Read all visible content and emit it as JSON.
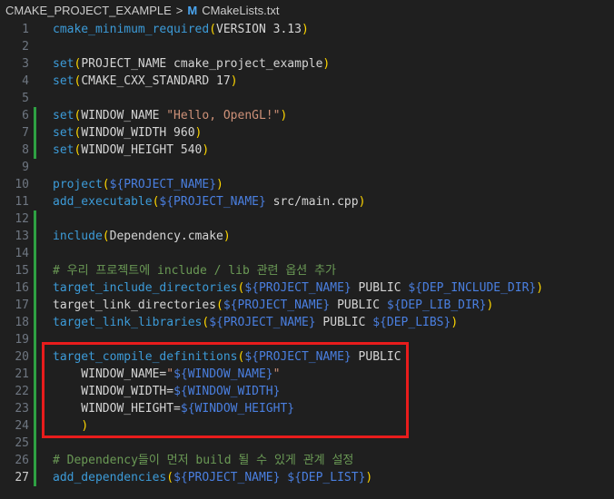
{
  "breadcrumb": {
    "folder": "CMAKE_PROJECT_EXAMPLE",
    "separator": ">",
    "file_icon": "M",
    "file": "CMakeLists.txt"
  },
  "editor": {
    "active_line": 27,
    "lines": [
      {
        "n": 1,
        "tokens": [
          [
            "fn",
            "cmake_minimum_required"
          ],
          [
            "pn",
            "("
          ],
          [
            "id",
            "VERSION 3.13"
          ],
          [
            "pn",
            ")"
          ]
        ]
      },
      {
        "n": 2,
        "tokens": []
      },
      {
        "n": 3,
        "tokens": [
          [
            "fn",
            "set"
          ],
          [
            "pn",
            "("
          ],
          [
            "id",
            "PROJECT_NAME cmake_project_example"
          ],
          [
            "pn",
            ")"
          ]
        ]
      },
      {
        "n": 4,
        "tokens": [
          [
            "fn",
            "set"
          ],
          [
            "pn",
            "("
          ],
          [
            "id",
            "CMAKE_CXX_STANDARD 17"
          ],
          [
            "pn",
            ")"
          ]
        ]
      },
      {
        "n": 5,
        "tokens": []
      },
      {
        "n": 6,
        "tokens": [
          [
            "fn",
            "set"
          ],
          [
            "pn",
            "("
          ],
          [
            "id",
            "WINDOW_NAME "
          ],
          [
            "st",
            "\"Hello, OpenGL!\""
          ],
          [
            "pn",
            ")"
          ]
        ]
      },
      {
        "n": 7,
        "tokens": [
          [
            "fn",
            "set"
          ],
          [
            "pn",
            "("
          ],
          [
            "id",
            "WINDOW_WIDTH 960"
          ],
          [
            "pn",
            ")"
          ]
        ]
      },
      {
        "n": 8,
        "tokens": [
          [
            "fn",
            "set"
          ],
          [
            "pn",
            "("
          ],
          [
            "id",
            "WINDOW_HEIGHT 540"
          ],
          [
            "pn",
            ")"
          ]
        ]
      },
      {
        "n": 9,
        "tokens": []
      },
      {
        "n": 10,
        "tokens": [
          [
            "fn",
            "project"
          ],
          [
            "pn",
            "("
          ],
          [
            "vr",
            "${PROJECT_NAME}"
          ],
          [
            "pn",
            ")"
          ]
        ]
      },
      {
        "n": 11,
        "tokens": [
          [
            "fn",
            "add_executable"
          ],
          [
            "pn",
            "("
          ],
          [
            "vr",
            "${PROJECT_NAME}"
          ],
          [
            "id",
            " src/main.cpp"
          ],
          [
            "pn",
            ")"
          ]
        ]
      },
      {
        "n": 12,
        "tokens": []
      },
      {
        "n": 13,
        "tokens": [
          [
            "fn",
            "include"
          ],
          [
            "pn",
            "("
          ],
          [
            "id",
            "Dependency.cmake"
          ],
          [
            "pn",
            ")"
          ]
        ]
      },
      {
        "n": 14,
        "tokens": []
      },
      {
        "n": 15,
        "tokens": [
          [
            "cm",
            "# 우리 프로젝트에 include / lib 관련 옵션 추가"
          ]
        ]
      },
      {
        "n": 16,
        "tokens": [
          [
            "fn",
            "target_include_directories"
          ],
          [
            "pn",
            "("
          ],
          [
            "vr",
            "${PROJECT_NAME}"
          ],
          [
            "id",
            " PUBLIC "
          ],
          [
            "vr",
            "${DEP_INCLUDE_DIR}"
          ],
          [
            "pn",
            ")"
          ]
        ]
      },
      {
        "n": 17,
        "tokens": [
          [
            "id",
            "target_link_directories"
          ],
          [
            "pn",
            "("
          ],
          [
            "vr",
            "${PROJECT_NAME}"
          ],
          [
            "id",
            " PUBLIC "
          ],
          [
            "vr",
            "${DEP_LIB_DIR}"
          ],
          [
            "pn",
            ")"
          ]
        ]
      },
      {
        "n": 18,
        "tokens": [
          [
            "fn",
            "target_link_libraries"
          ],
          [
            "pn",
            "("
          ],
          [
            "vr",
            "${PROJECT_NAME}"
          ],
          [
            "id",
            " PUBLIC "
          ],
          [
            "vr",
            "${DEP_LIBS}"
          ],
          [
            "pn",
            ")"
          ]
        ]
      },
      {
        "n": 19,
        "tokens": []
      },
      {
        "n": 20,
        "tokens": [
          [
            "fn",
            "target_compile_definitions"
          ],
          [
            "pn",
            "("
          ],
          [
            "vr",
            "${PROJECT_NAME}"
          ],
          [
            "id",
            " PUBLIC"
          ]
        ]
      },
      {
        "n": 21,
        "tokens": [
          [
            "id",
            "    WINDOW_NAME="
          ],
          [
            "st",
            "\""
          ],
          [
            "vr",
            "${WINDOW_NAME}"
          ],
          [
            "st",
            "\""
          ]
        ]
      },
      {
        "n": 22,
        "tokens": [
          [
            "id",
            "    WINDOW_WIDTH="
          ],
          [
            "vr",
            "${WINDOW_WIDTH}"
          ]
        ]
      },
      {
        "n": 23,
        "tokens": [
          [
            "id",
            "    WINDOW_HEIGHT="
          ],
          [
            "vr",
            "${WINDOW_HEIGHT}"
          ]
        ]
      },
      {
        "n": 24,
        "tokens": [
          [
            "id",
            "    "
          ],
          [
            "pn",
            ")"
          ]
        ]
      },
      {
        "n": 25,
        "tokens": []
      },
      {
        "n": 26,
        "tokens": [
          [
            "cm",
            "# Dependency들이 먼저 build 될 수 있게 관계 설정"
          ]
        ]
      },
      {
        "n": 27,
        "tokens": [
          [
            "fn",
            "add_dependencies"
          ],
          [
            "pn",
            "("
          ],
          [
            "vr",
            "${PROJECT_NAME}"
          ],
          [
            "id",
            " "
          ],
          [
            "vr",
            "${DEP_LIST}"
          ],
          [
            "pn",
            ")"
          ]
        ]
      }
    ]
  },
  "gutter_changes": [
    [
      6,
      8
    ],
    [
      12,
      27
    ]
  ],
  "highlight": {
    "from_line": 20,
    "to_line": 24,
    "color": "#e81c1c"
  }
}
